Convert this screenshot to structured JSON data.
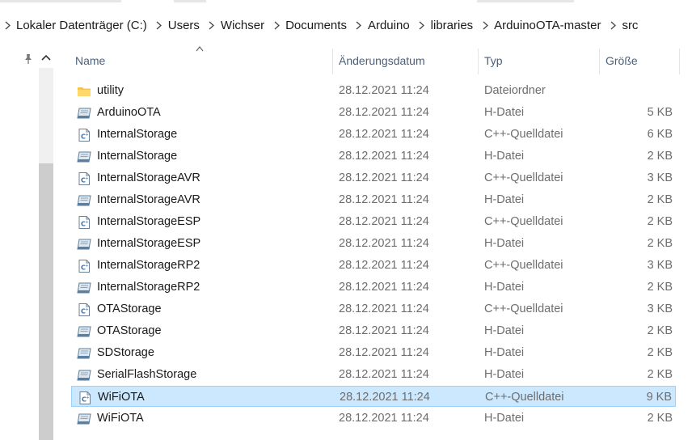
{
  "breadcrumb": [
    "Lokaler Datenträger (C:)",
    "Users",
    "Wichser",
    "Documents",
    "Arduino",
    "libraries",
    "ArduinoOTA-master",
    "src"
  ],
  "columns": {
    "name": "Name",
    "date": "Änderungsdatum",
    "type": "Typ",
    "size": "Größe"
  },
  "files": [
    {
      "name": "utility",
      "date": "28.12.2021 11:24",
      "type": "Dateiordner",
      "size": "",
      "icon": "folder-icon"
    },
    {
      "name": "ArduinoOTA",
      "date": "28.12.2021 11:24",
      "type": "H-Datei",
      "size": "5 KB",
      "icon": "h-file-icon"
    },
    {
      "name": "InternalStorage",
      "date": "28.12.2021 11:24",
      "type": "C++-Quelldatei",
      "size": "6 KB",
      "icon": "cpp-file-icon"
    },
    {
      "name": "InternalStorage",
      "date": "28.12.2021 11:24",
      "type": "H-Datei",
      "size": "2 KB",
      "icon": "h-file-icon"
    },
    {
      "name": "InternalStorageAVR",
      "date": "28.12.2021 11:24",
      "type": "C++-Quelldatei",
      "size": "3 KB",
      "icon": "cpp-file-icon"
    },
    {
      "name": "InternalStorageAVR",
      "date": "28.12.2021 11:24",
      "type": "H-Datei",
      "size": "2 KB",
      "icon": "h-file-icon"
    },
    {
      "name": "InternalStorageESP",
      "date": "28.12.2021 11:24",
      "type": "C++-Quelldatei",
      "size": "2 KB",
      "icon": "cpp-file-icon"
    },
    {
      "name": "InternalStorageESP",
      "date": "28.12.2021 11:24",
      "type": "H-Datei",
      "size": "2 KB",
      "icon": "h-file-icon"
    },
    {
      "name": "InternalStorageRP2",
      "date": "28.12.2021 11:24",
      "type": "C++-Quelldatei",
      "size": "3 KB",
      "icon": "cpp-file-icon"
    },
    {
      "name": "InternalStorageRP2",
      "date": "28.12.2021 11:24",
      "type": "H-Datei",
      "size": "2 KB",
      "icon": "h-file-icon"
    },
    {
      "name": "OTAStorage",
      "date": "28.12.2021 11:24",
      "type": "C++-Quelldatei",
      "size": "3 KB",
      "icon": "cpp-file-icon"
    },
    {
      "name": "OTAStorage",
      "date": "28.12.2021 11:24",
      "type": "H-Datei",
      "size": "2 KB",
      "icon": "h-file-icon"
    },
    {
      "name": "SDStorage",
      "date": "28.12.2021 11:24",
      "type": "H-Datei",
      "size": "2 KB",
      "icon": "h-file-icon"
    },
    {
      "name": "SerialFlashStorage",
      "date": "28.12.2021 11:24",
      "type": "H-Datei",
      "size": "2 KB",
      "icon": "h-file-icon"
    },
    {
      "name": "WiFiOTA",
      "date": "28.12.2021 11:24",
      "type": "C++-Quelldatei",
      "size": "9 KB",
      "icon": "cpp-file-icon",
      "selected": true
    },
    {
      "name": "WiFiOTA",
      "date": "28.12.2021 11:24",
      "type": "H-Datei",
      "size": "2 KB",
      "icon": "h-file-icon"
    }
  ],
  "colors": {
    "selection_bg": "#cce8ff",
    "selection_border": "#99d1ff",
    "header_text": "#4c607a",
    "secondary_text": "#6d6d6d",
    "folder": "#f6c453"
  }
}
